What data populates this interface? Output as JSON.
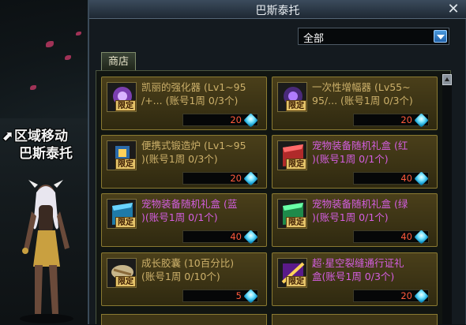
{
  "window": {
    "title": "巴斯泰托",
    "close_glyph": "✕"
  },
  "filter": {
    "selected": "全部"
  },
  "tabs": [
    {
      "label": "商店"
    }
  ],
  "zone": {
    "action": "区域移动",
    "name": "巴斯泰托"
  },
  "currency_icon": "crystal-gem-icon",
  "limit_badge": "限定",
  "items": [
    {
      "line1": "凯丽的强化器 (Lv1~95",
      "line2": "/+... (账号1周 0/3个)",
      "price": "20",
      "color": "#ccb06a",
      "icon": "enhancer-icon"
    },
    {
      "line1": "一次性增幅器 (Lv55~",
      "line2": "95/... (账号1周 0/3个)",
      "price": "20",
      "color": "#ccb06a",
      "icon": "amplifier-icon"
    },
    {
      "line1": "便携式锻造炉 (Lv1~95",
      "line2": ")(账号1周 0/3个)",
      "price": "20",
      "color": "#ccb06a",
      "icon": "forge-icon"
    },
    {
      "line1": "宠物装备随机礼盒 (红",
      "line2": ")(账号1周 0/1个)",
      "price": "40",
      "color": "#d45ee0",
      "icon": "red-gift-box-icon"
    },
    {
      "line1": "宠物装备随机礼盒 (蓝",
      "line2": ")(账号1周 0/1个)",
      "price": "40",
      "color": "#d45ee0",
      "icon": "blue-gift-box-icon"
    },
    {
      "line1": "宠物装备随机礼盒 (绿",
      "line2": ")(账号1周 0/1个)",
      "price": "40",
      "color": "#d45ee0",
      "icon": "green-gift-box-icon"
    },
    {
      "line1": "成长胶囊 (10百分比)",
      "line2": "(账号1周 0/10个)",
      "price": "5",
      "color": "#ccb06a",
      "icon": "capsule-icon"
    },
    {
      "line1": "超·星空裂缝通行证礼",
      "line2": "盒(账号1周 0/3个)",
      "price": "20",
      "color": "#d45ee0",
      "icon": "pass-gift-box-icon"
    }
  ]
}
